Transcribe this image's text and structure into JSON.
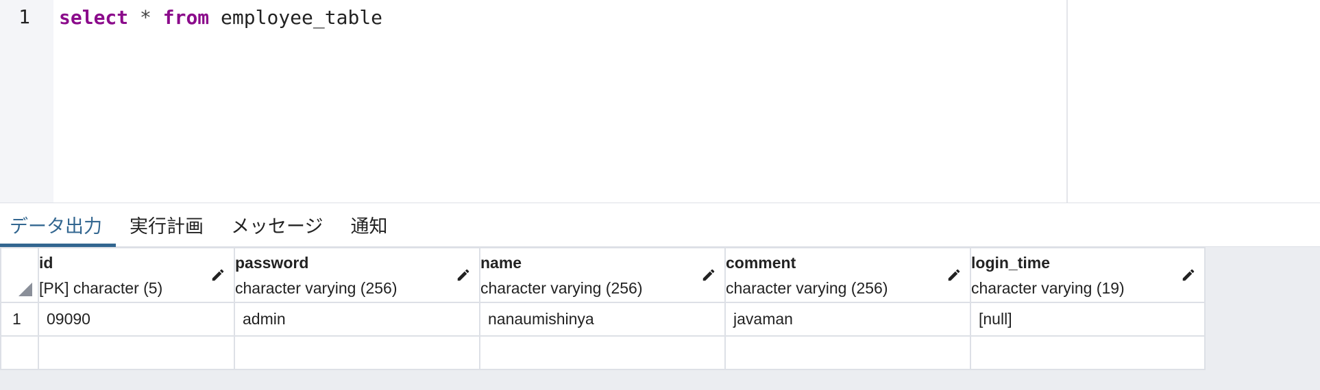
{
  "editor": {
    "line_numbers": [
      "1"
    ],
    "code": {
      "kw1": "select",
      "op": "*",
      "kw2": "from",
      "ident": "employee_table"
    }
  },
  "tabs": [
    {
      "label": "データ出力",
      "active": true
    },
    {
      "label": "実行計画",
      "active": false
    },
    {
      "label": "メッセージ",
      "active": false
    },
    {
      "label": "通知",
      "active": false
    }
  ],
  "grid": {
    "columns": [
      {
        "name": "id",
        "type": "[PK] character (5)"
      },
      {
        "name": "password",
        "type": "character varying (256)"
      },
      {
        "name": "name",
        "type": "character varying (256)"
      },
      {
        "name": "comment",
        "type": "character varying (256)"
      },
      {
        "name": "login_time",
        "type": "character varying (19)"
      }
    ],
    "rows": [
      {
        "num": "1",
        "cells": [
          "09090",
          "admin",
          "nanaumishinya",
          "javaman",
          "[null]"
        ]
      },
      {
        "num": "",
        "cells": [
          "",
          "",
          "",
          "",
          ""
        ]
      }
    ]
  },
  "icons": {
    "edit": "pencil-icon",
    "corner": "select-all-triangle-icon"
  },
  "colors": {
    "keyword": "#8b0b8b",
    "active_tab": "#326690",
    "null_text": "#6c7a8c"
  }
}
